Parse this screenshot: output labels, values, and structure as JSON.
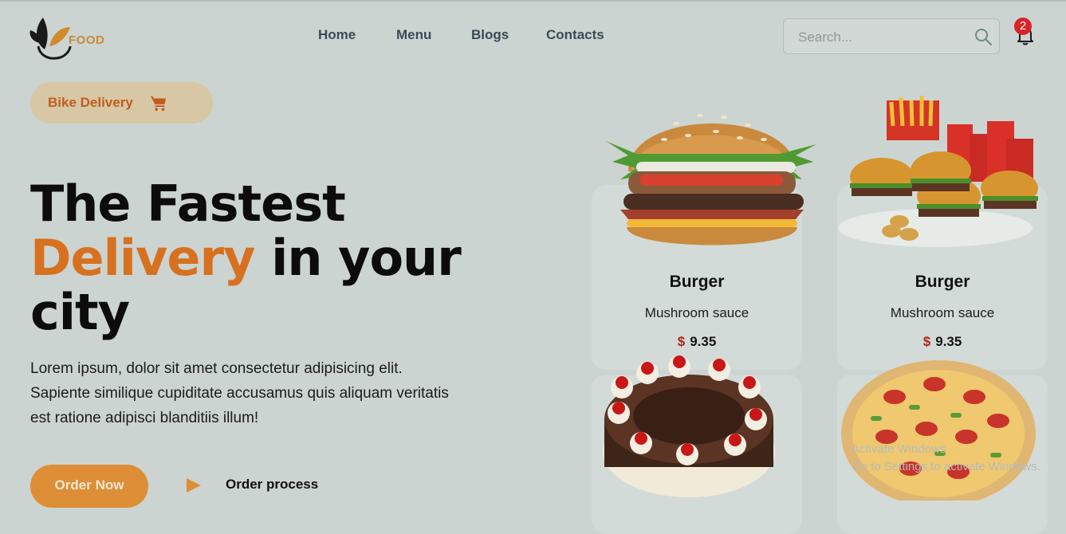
{
  "brand": {
    "logo_text": "FOOD"
  },
  "nav": [
    {
      "label": "Home"
    },
    {
      "label": "Menu"
    },
    {
      "label": "Blogs"
    },
    {
      "label": "Contacts"
    }
  ],
  "search": {
    "placeholder": "Search..."
  },
  "notifications": {
    "count": "2"
  },
  "delivery_pill": {
    "label": "Bike Delivery"
  },
  "hero": {
    "line1": "The Fastest",
    "accent": "Delivery",
    "line2_rest": " in your",
    "line3": "city"
  },
  "description": "Lorem ipsum, dolor sit amet consectetur adipisicing elit. Sapiente similique cupiditate accusamus quis aliquam veritatis est ratione adipisci blanditiis illum!",
  "cta": {
    "order_now": "Order Now",
    "order_process": "Order process"
  },
  "cards": [
    {
      "name": "Burger",
      "desc": "Mushroom sauce",
      "currency": "$",
      "price": "9.35"
    },
    {
      "name": "Burger",
      "desc": "Mushroom sauce",
      "currency": "$",
      "price": "9.35"
    }
  ],
  "watermark": {
    "line1": "Activate Windows",
    "line2": "Go to Settings to activate Windows."
  },
  "colors": {
    "accent": "#d7711f",
    "background": "#ccd4d1",
    "badge": "#d8232a",
    "price_currency": "#b02218"
  }
}
